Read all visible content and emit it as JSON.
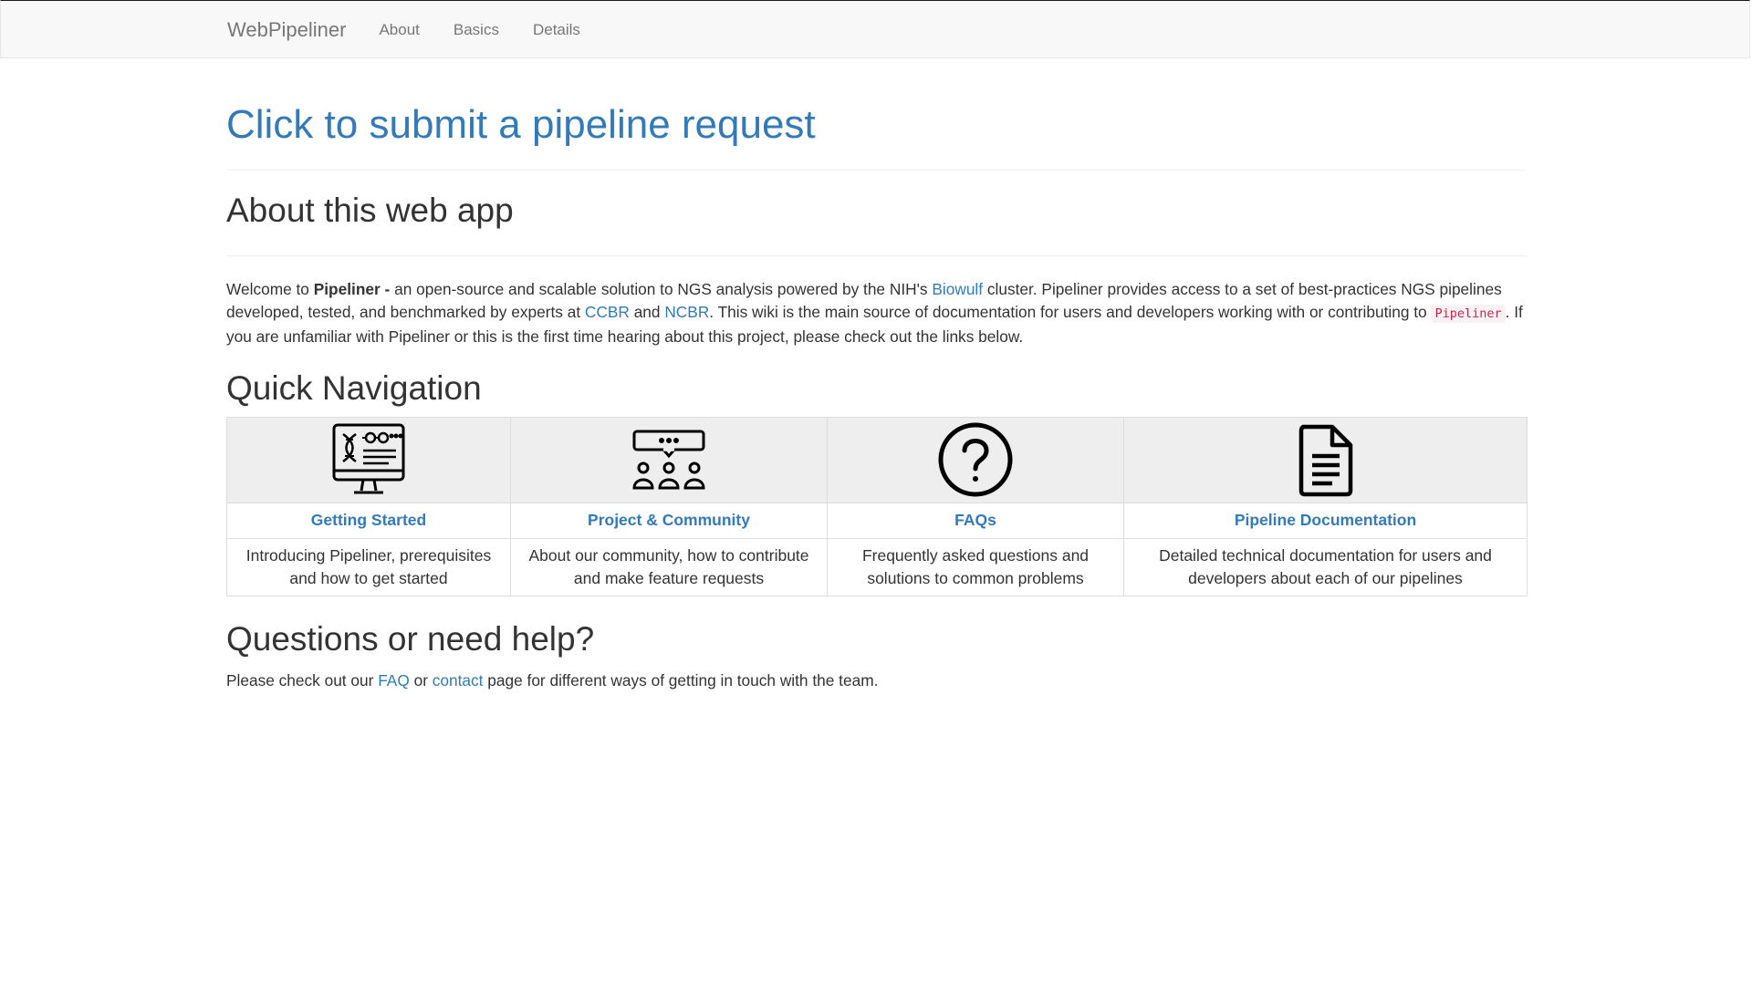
{
  "navbar": {
    "brand": "WebPipeliner",
    "links": [
      "About",
      "Basics",
      "Details"
    ]
  },
  "main": {
    "submit_link": "Click to submit a pipeline request",
    "about_heading": "About this web app",
    "intro": {
      "welcome": "Welcome to ",
      "pipeliner_bold": "Pipeliner -",
      "part1": " an open-source and scalable solution to NGS analysis powered by the NIH's ",
      "biowulf": "Biowulf",
      "part2": " cluster. Pipeliner provides access to a set of best-practices NGS pipelines developed, tested, and benchmarked by experts at ",
      "ccbr": "CCBR",
      "and": " and ",
      "ncbr": "NCBR",
      "part3": ". This wiki is the main source of documentation for users and developers working with or contributing to ",
      "code": "Pipeliner",
      "part4": ". If you are unfamiliar with Pipeliner or this is the first time hearing about this project, please check out the links below."
    },
    "quick_nav_heading": "Quick Navigation",
    "cards": [
      {
        "icon": "dna-monitor-icon",
        "title": "Getting Started",
        "desc": "Introducing Pipeliner, prerequisites and how to get started"
      },
      {
        "icon": "community-icon",
        "title": "Project & Community",
        "desc": "About our community, how to contribute and make feature requests"
      },
      {
        "icon": "question-icon",
        "title": "FAQs",
        "desc": "Frequently asked questions and solutions to common problems"
      },
      {
        "icon": "document-icon",
        "title": "Pipeline Documentation",
        "desc": "Detailed technical documentation for users and developers about each of our pipelines"
      }
    ],
    "help_heading": "Questions or need help?",
    "help": {
      "part1": "Please check out our ",
      "faq": "FAQ",
      "or": " or ",
      "contact": "contact",
      "part2": " page for different ways of getting in touch with the team."
    }
  },
  "colors": {
    "link": "#337ab7",
    "navbar_bg": "#f8f8f8",
    "table_header_bg": "#eeeeee",
    "code_text": "#c7254e"
  }
}
